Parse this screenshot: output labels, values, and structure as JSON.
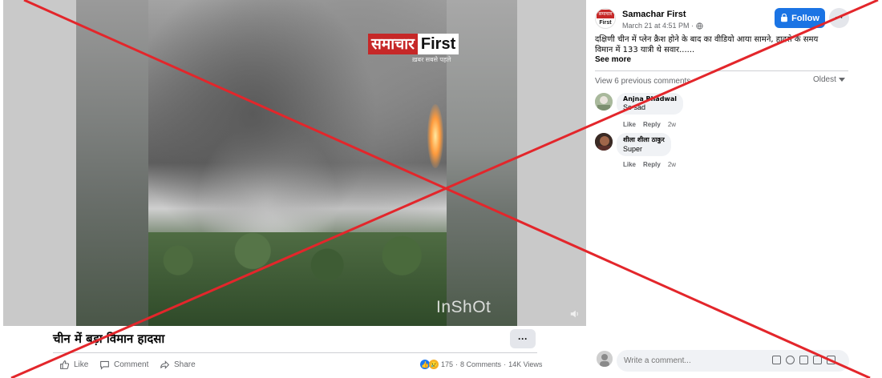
{
  "video": {
    "logo_hindi": "समाचार",
    "logo_english": "First",
    "logo_tagline": "ख़बर सबसे पहले",
    "watermark": "InShOt",
    "title": "चीन में बड़ा विमान हादसा",
    "more_label": "···"
  },
  "actions": {
    "like": "Like",
    "comment": "Comment",
    "share": "Share",
    "reaction_count": "175",
    "comments_count": "8 Comments",
    "views_count": "14K Views",
    "dot": "·"
  },
  "post": {
    "page_avatar_top": "समाचार",
    "page_avatar_bottom": "First",
    "page_name": "Samachar First",
    "timestamp": "March 21 at 4:51 PM ·",
    "follow_label": "Follow",
    "more_label": "···",
    "text_line1": "दक्षिणी चीन में प्लेन क्रैश होने के बाद का वीडियो आया सामने, हादसे के समय",
    "text_line2": "विमान में 133 यात्री थे सवार......",
    "see_more": "See more"
  },
  "comments": {
    "view_previous": "View 6 previous comments",
    "sort_label": "Oldest",
    "items": [
      {
        "name": "Anjna Bhadwal",
        "text": "So sad",
        "like": "Like",
        "reply": "Reply",
        "time": "2w"
      },
      {
        "name": "शीला शीला ठाकुर",
        "text": "Super",
        "like": "Like",
        "reply": "Reply",
        "time": "2w"
      }
    ],
    "write_placeholder": "Write a comment..."
  },
  "colors": {
    "overlay_x": "#e3262b",
    "follow_button": "#1b74e4",
    "brand_red": "#c62828"
  }
}
